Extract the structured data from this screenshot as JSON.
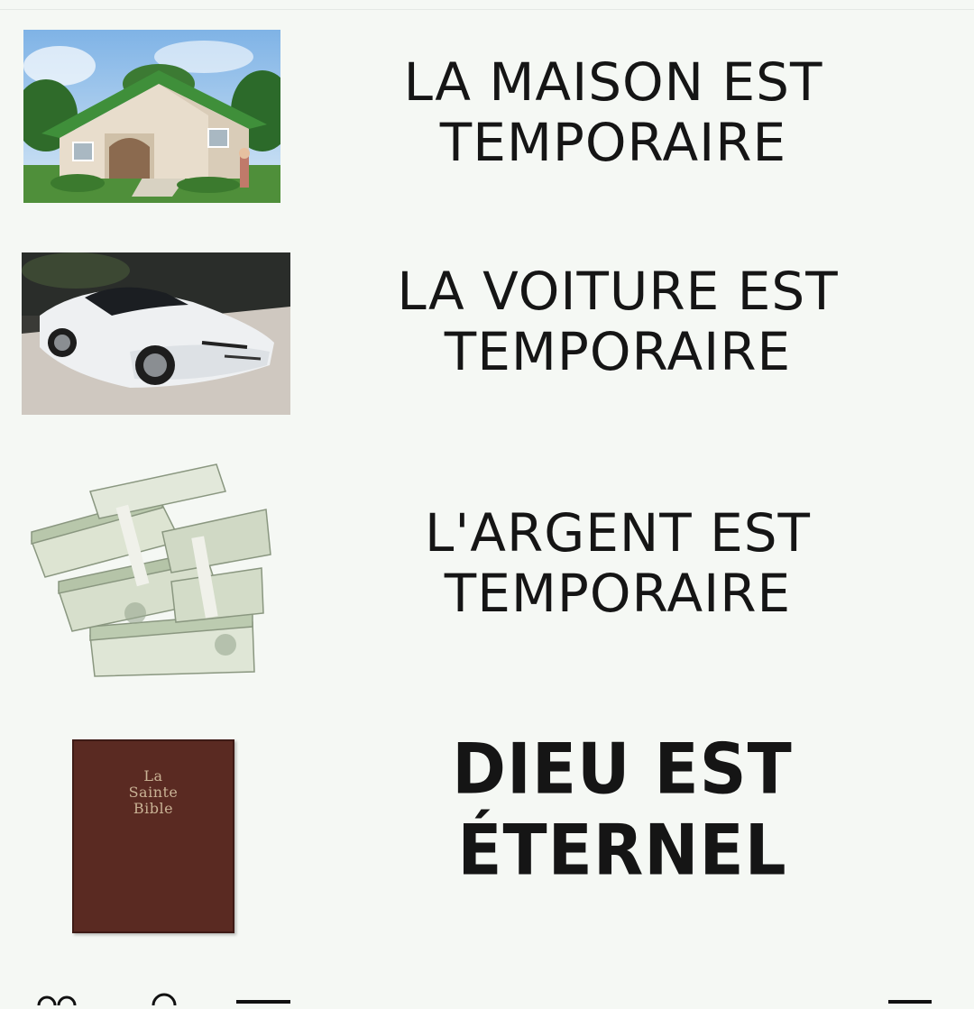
{
  "items": [
    {
      "caption_line1": "LA MAISON EST",
      "caption_line2": "TEMPORAIRE",
      "image": "house-photo"
    },
    {
      "caption_line1": "LA VOITURE EST",
      "caption_line2": "TEMPORAIRE",
      "image": "car-photo"
    },
    {
      "caption_line1": "L'ARGENT EST",
      "caption_line2": "TEMPORAIRE",
      "image": "money-photo"
    },
    {
      "caption_line1": "DIEU EST",
      "caption_line2": "ÉTERNEL",
      "image": "bible-photo"
    }
  ],
  "bible_cover_text": "La Sainte Bible",
  "colors": {
    "background": "#f5f8f4",
    "text": "#151515",
    "roof": "#3f8f3a",
    "car": "#eef0f2",
    "money": "#cfd8c8",
    "bible": "#5a2a22"
  }
}
